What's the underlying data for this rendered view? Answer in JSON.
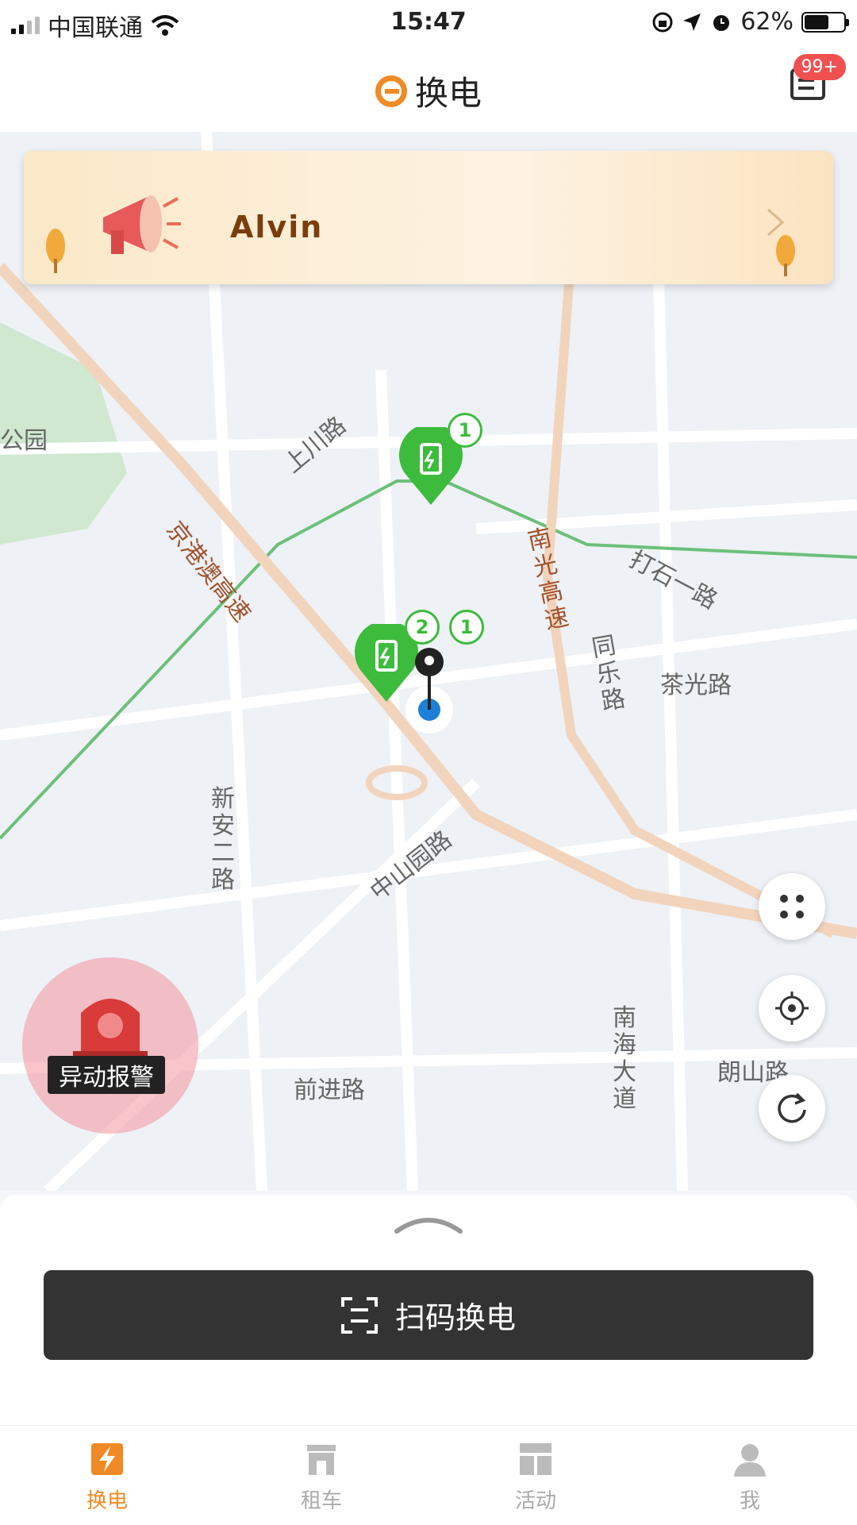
{
  "status_bar": {
    "carrier": "中国联通",
    "time": "15:47",
    "battery": "62%",
    "battery_level": 0.62
  },
  "header": {
    "title": "换电",
    "badge": "99+"
  },
  "banner": {
    "name": "Alvin"
  },
  "map": {
    "roads": [
      "上川路",
      "京港澳高速",
      "南光高速",
      "打石一路",
      "同乐路",
      "茶光路",
      "新安二路",
      "中山园路",
      "南海大道",
      "朗山路",
      "前进路"
    ],
    "park": "公园",
    "markers": [
      {
        "count": "1"
      },
      {
        "count": "2"
      },
      {
        "count": "1"
      }
    ]
  },
  "alarm": {
    "label": "异动报警"
  },
  "scan_button": {
    "label": "扫码换电"
  },
  "tabs": [
    {
      "label": "换电",
      "icon": "bolt-icon",
      "active": true
    },
    {
      "label": "租车",
      "icon": "shop-icon",
      "active": false
    },
    {
      "label": "活动",
      "icon": "grid-icon",
      "active": false
    },
    {
      "label": "我",
      "icon": "user-icon",
      "active": false
    }
  ],
  "colors": {
    "accent": "#f08a24",
    "marker_green": "#3dbb3d",
    "button_dark": "#333333",
    "badge_red": "#f05050"
  }
}
